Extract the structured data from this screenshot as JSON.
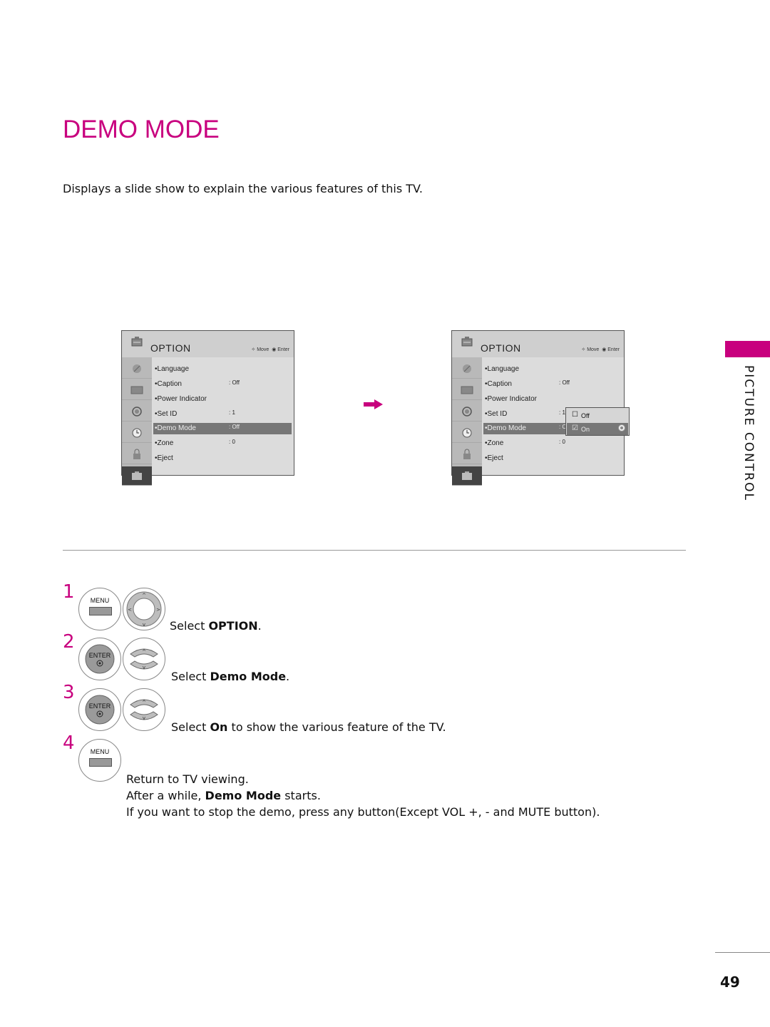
{
  "page": {
    "title": "DEMO MODE",
    "subtitle": "Displays a slide show to explain the various features of this TV.",
    "section_label": "PICTURE CONTROL",
    "page_number": "49",
    "accent_color": "#c8007e"
  },
  "osd_before": {
    "title": "OPTION",
    "hint_move": "Move",
    "hint_enter": "Enter",
    "items": [
      {
        "label": "Language",
        "value": ""
      },
      {
        "label": "Caption",
        "value": ": Off"
      },
      {
        "label": "Power Indicator",
        "value": ""
      },
      {
        "label": "Set ID",
        "value": ": 1"
      },
      {
        "label": "Demo Mode",
        "value": ": Off"
      },
      {
        "label": "Zone",
        "value": ": 0"
      },
      {
        "label": "Eject",
        "value": ""
      }
    ],
    "selected_index": 4
  },
  "osd_after": {
    "title": "OPTION",
    "hint_move": "Move",
    "hint_enter": "Enter",
    "items": [
      {
        "label": "Language",
        "value": ""
      },
      {
        "label": "Caption",
        "value": ": Off"
      },
      {
        "label": "Power Indicator",
        "value": ""
      },
      {
        "label": "Set ID",
        "value": ": 1"
      },
      {
        "label": "Demo Mode",
        "value": ": Off"
      },
      {
        "label": "Zone",
        "value": ": 0"
      },
      {
        "label": "Eject",
        "value": ""
      }
    ],
    "selected_index": 4,
    "popup": {
      "options": [
        {
          "label": "Off",
          "checked": false
        },
        {
          "label": "On",
          "checked": true
        }
      ],
      "selected_index": 1
    }
  },
  "buttons": {
    "menu": "MENU",
    "enter": "ENTER"
  },
  "steps": [
    {
      "number": "1",
      "prefix": "Select ",
      "bold": "OPTION",
      "suffix": "."
    },
    {
      "number": "2",
      "prefix": "Select ",
      "bold": "Demo Mode",
      "suffix": "."
    },
    {
      "number": "3",
      "prefix": "Select ",
      "bold": "On",
      "suffix": " to show the various feature of the TV."
    },
    {
      "number": "4",
      "line1": "Return to TV viewing.",
      "line2_prefix": "After a while, ",
      "line2_bold": "Demo Mode",
      "line2_suffix": " starts.",
      "line3": "If you want to stop the demo, press any button(Except VOL +, - and MUTE button)."
    }
  ]
}
